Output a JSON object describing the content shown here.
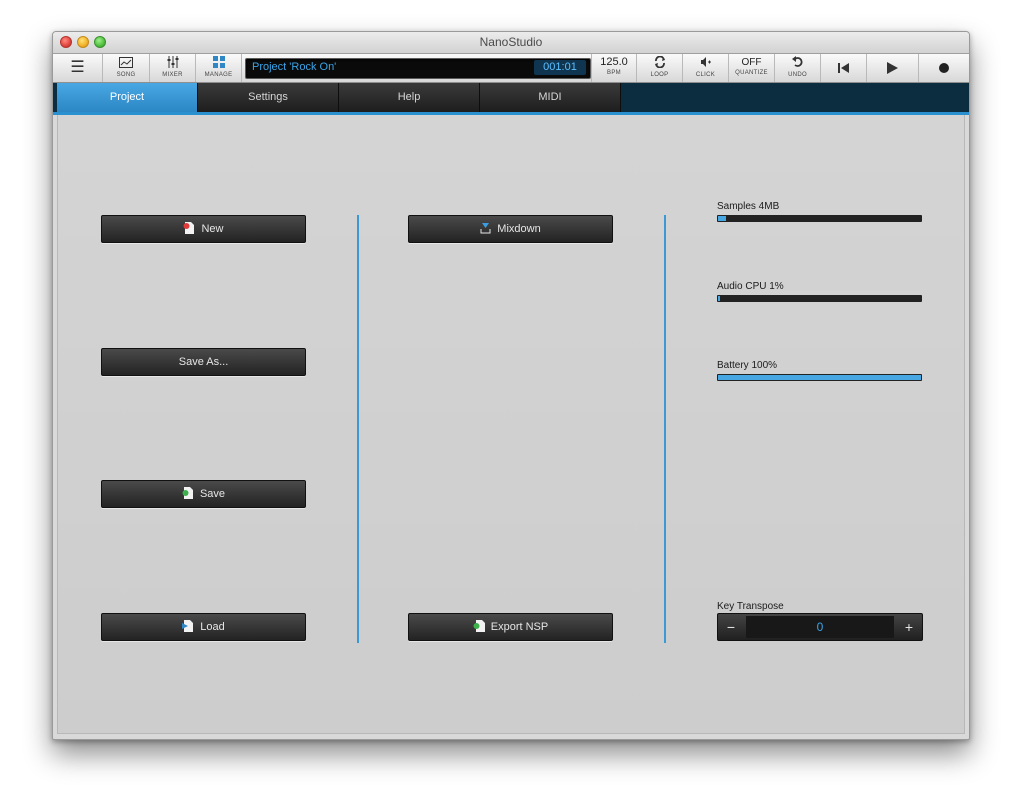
{
  "window": {
    "title": "NanoStudio"
  },
  "toolbar": {
    "menu_icon": "hamburger-menu-icon",
    "song_label": "SONG",
    "mixer_label": "MIXER",
    "manage_label": "MANAGE",
    "project_name": "Project 'Rock On'",
    "time": "001:01",
    "bpm_value": "125.0",
    "bpm_label": "BPM",
    "loop_label": "LOOP",
    "click_label": "CLICK",
    "quantize_value": "OFF",
    "quantize_label": "QUANTIZE",
    "undo_label": "UNDO"
  },
  "tabs": [
    {
      "label": "Project",
      "active": true
    },
    {
      "label": "Settings",
      "active": false
    },
    {
      "label": "Help",
      "active": false
    },
    {
      "label": "MIDI",
      "active": false
    }
  ],
  "buttons": {
    "new": "New",
    "save_as": "Save As...",
    "save": "Save",
    "load": "Load",
    "mixdown": "Mixdown",
    "export_nsp": "Export NSP"
  },
  "meters": [
    {
      "label": "Samples 4MB",
      "level": 0.04
    },
    {
      "label": "Audio CPU 1%",
      "level": 0.01
    },
    {
      "label": "Battery 100%",
      "level": 1.0
    }
  ],
  "transpose": {
    "label": "Key Transpose",
    "minus": "−",
    "plus": "+",
    "value": "0"
  },
  "colors": {
    "accent": "#2f8fd0",
    "panel": "#d2d2d2",
    "button": "#2b2b2b"
  }
}
